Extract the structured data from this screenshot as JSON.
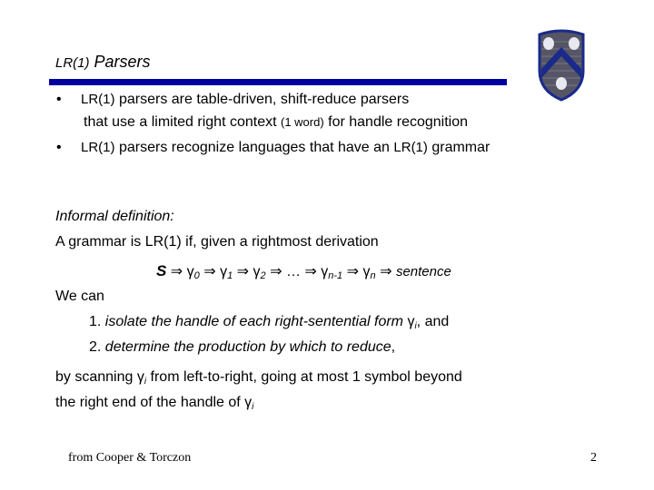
{
  "slide": {
    "title_prefix": "LR(1)",
    "title_rest": "Parsers",
    "logo": "rice-university-crest-icon",
    "bullets": [
      {
        "symbol": "•",
        "line1_prefix": "LR(1)",
        "line1_rest": " parsers are table-driven, shift-reduce parsers",
        "line2_a": "that use a limited right context ",
        "line2_small": "(1 word)",
        "line2_b": " for handle recognition"
      },
      {
        "symbol": "•",
        "prefix": "LR(1)",
        "middle": " parsers recognize languages that have an ",
        "lr": "LR(1)",
        "suffix": " grammar"
      }
    ],
    "informal_label": "Informal definition:",
    "definition": "A grammar is LR(1) if, given a rightmost derivation",
    "derivation": {
      "start": "S",
      "arrow": "⇒",
      "gamma": "γ",
      "subs": [
        "0",
        "1",
        "2"
      ],
      "ellipsis": "…",
      "sub_nminus1": "n-1",
      "sub_n": "n",
      "end": "sentence"
    },
    "we_can": "We can",
    "steps": [
      {
        "num": "1. ",
        "text": "isolate the handle of each right-sentential form ",
        "gamma": "γ",
        "sub": "i",
        "tail": ", and"
      },
      {
        "num": "2. ",
        "text": "determine the production by which to reduce",
        "tail": ","
      }
    ],
    "scan_line1_a": "by scanning ",
    "scan_gamma": "γ",
    "scan_sub": "i",
    "scan_line1_b": " from left-to-right, going at most 1 symbol beyond",
    "scan_line2_a": "the right end of the handle of ",
    "scan_line2_gamma": "γ",
    "scan_line2_sub": "i",
    "footer_credit": "from Cooper & Torczon",
    "page_number": "2",
    "colors": {
      "rule": "#0000a0",
      "crest_blue": "#1a2a8a",
      "crest_grey": "#555566"
    }
  }
}
